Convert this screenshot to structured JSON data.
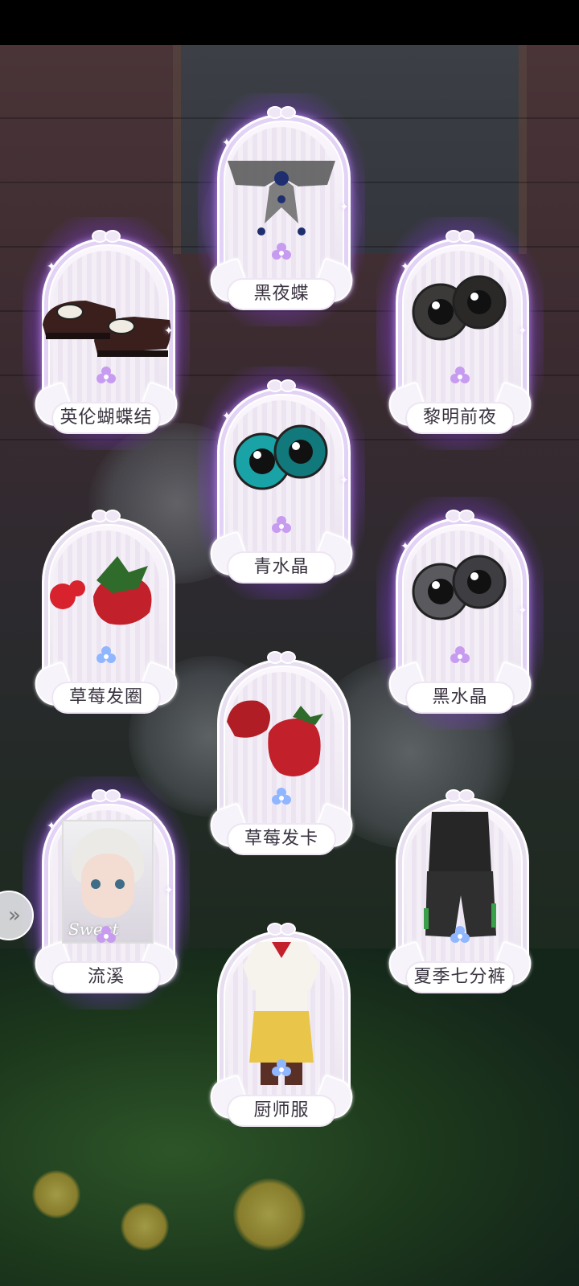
{
  "cards": [
    {
      "id": "heiyedie",
      "label": "黑夜蝶",
      "rarity": "purple",
      "item_icon": "bow-collar-icon"
    },
    {
      "id": "yinglun",
      "label": "英伦蝴蝶结",
      "rarity": "purple",
      "item_icon": "shoes-icon"
    },
    {
      "id": "liming",
      "label": "黎明前夜",
      "rarity": "purple",
      "item_icon": "dark-eyes-icon"
    },
    {
      "id": "qingshuijing",
      "label": "青水晶",
      "rarity": "purple",
      "item_icon": "teal-eyes-icon"
    },
    {
      "id": "caomeifaquan",
      "label": "草莓发圈",
      "rarity": "blue",
      "item_icon": "strawberry-hairband-icon"
    },
    {
      "id": "heishuijing",
      "label": "黑水晶",
      "rarity": "purple",
      "item_icon": "grey-eyes-icon"
    },
    {
      "id": "caomeifaka",
      "label": "草莓发卡",
      "rarity": "blue",
      "item_icon": "strawberry-clip-icon"
    },
    {
      "id": "liuxi",
      "label": "流溪",
      "rarity": "purple",
      "item_icon": "doll-portrait-icon",
      "portrait_text": "Sweet"
    },
    {
      "id": "xiaji",
      "label": "夏季七分裤",
      "rarity": "blue",
      "item_icon": "pants-outfit-icon"
    },
    {
      "id": "chushifu",
      "label": "厨师服",
      "rarity": "blue",
      "item_icon": "chef-outfit-icon"
    }
  ],
  "colors": {
    "purple_glow": "#b46eff",
    "blue_clover": "#8fb6ff",
    "purple_clover": "#c79cf0"
  }
}
